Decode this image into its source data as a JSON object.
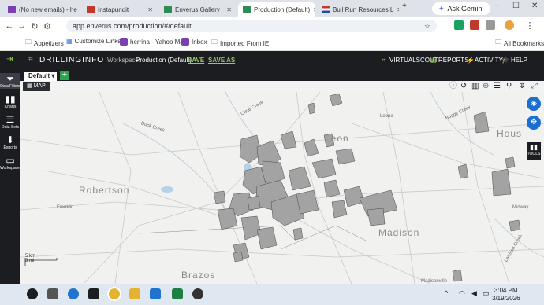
{
  "browser": {
    "tabs": [
      {
        "label": "(No new emails) - he",
        "color": "#7b3fb0"
      },
      {
        "label": "Instapundit",
        "color": "#c0392b"
      },
      {
        "label": "Enverus Gallery",
        "color": "#2e8b57"
      },
      {
        "label": "Production (Default)",
        "color": "#2e8b57"
      },
      {
        "label": "Bull Run Resources L",
        "color": "#c0392b"
      }
    ],
    "gemini_label": "Ask Gemini",
    "url": "app.enverus.com/production/#/default",
    "bookmarks": [
      "Appetizers",
      "Customize Links",
      "herrina - Yahoo Mail",
      "Inbox",
      "Imported From IE"
    ],
    "all_bookmarks": "All Bookmarks"
  },
  "app": {
    "logo": "DRILLINGINFO",
    "workspace_label": "Workspace:",
    "workspace_name": "Production (Default)",
    "save": "SAVE",
    "save_as": "SAVE AS",
    "header_links": [
      "VIRTUALSCOUT",
      "REPORTS",
      "ACTIVITY",
      "HELP"
    ],
    "ws_tab": "Default",
    "map_tab": "MAP",
    "sidebar": [
      {
        "label": "Data Filters",
        "icon": "filter-icon"
      },
      {
        "label": "Charts",
        "icon": "chart-icon"
      },
      {
        "label": "Data Sets",
        "icon": "database-icon"
      },
      {
        "label": "Exports",
        "icon": "download-icon"
      },
      {
        "label": "Workspaces",
        "icon": "window-icon"
      }
    ],
    "tools_label": "TOOLS"
  },
  "map": {
    "counties": [
      "Leon",
      "Robertson",
      "Madison",
      "Brazos",
      "Hous"
    ],
    "towns": [
      "Leona",
      "Franklin",
      "Midway",
      "Madisonville"
    ],
    "creeks": [
      "Duck Creek",
      "Clear Creek",
      "Buggy Creek",
      "Larrison Creek"
    ],
    "scale_km": "5 km",
    "scale_mi": "3 mi"
  },
  "taskbar": {
    "time": "3:04 PM",
    "date": "3/19/2026"
  }
}
